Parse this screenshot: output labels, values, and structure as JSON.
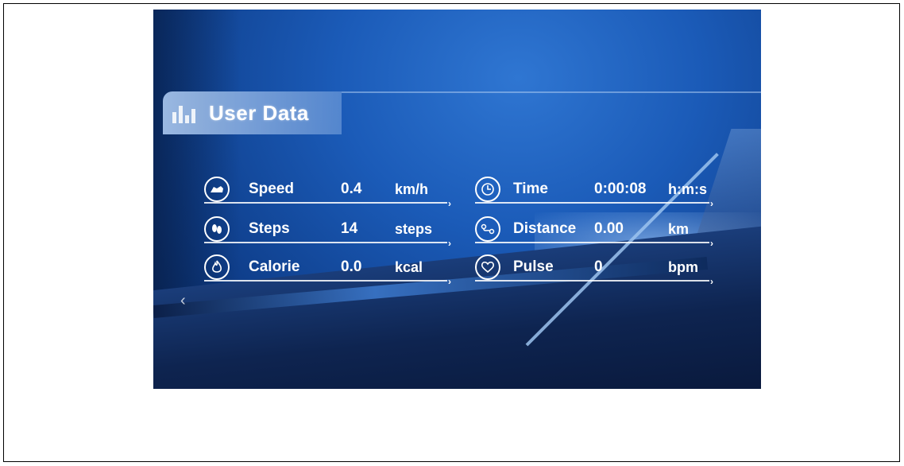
{
  "header": {
    "title": "User Data",
    "icon": "bar-chart-icon"
  },
  "left_metrics": [
    {
      "icon": "speed-shoe-icon",
      "label": "Speed",
      "value": "0.4",
      "unit": "km/h"
    },
    {
      "icon": "steps-footprint-icon",
      "label": "Steps",
      "value": "14",
      "unit": "steps"
    },
    {
      "icon": "calorie-flame-icon",
      "label": "Calorie",
      "value": "0.0",
      "unit": "kcal"
    }
  ],
  "right_metrics": [
    {
      "icon": "clock-icon",
      "label": "Time",
      "value": "0:00:08",
      "unit": "h:m:s"
    },
    {
      "icon": "distance-route-icon",
      "label": "Distance",
      "value": "0.00",
      "unit": "km"
    },
    {
      "icon": "heart-pulse-icon",
      "label": "Pulse",
      "value": "0",
      "unit": "bpm"
    }
  ],
  "glyphs": {
    "arrow": "›",
    "back": "‹",
    "shoe": "👟",
    "feet": "👣",
    "flame": "♨",
    "clock": "◷",
    "route": "⊚",
    "heart": "♥"
  }
}
